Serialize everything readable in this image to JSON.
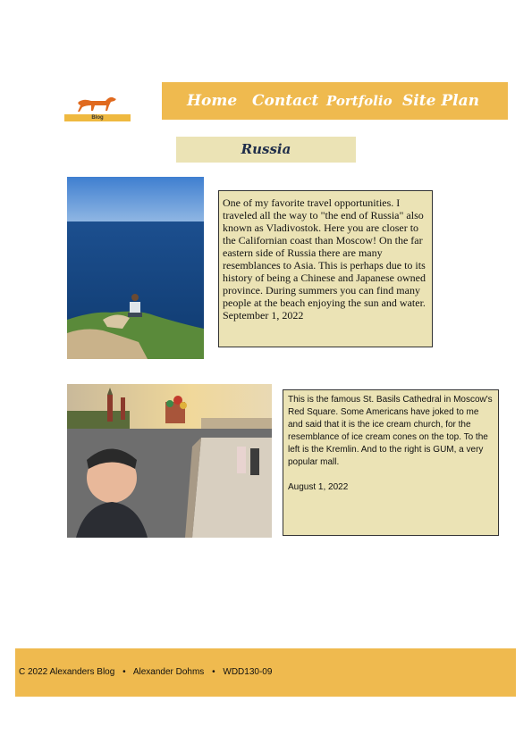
{
  "logo": {
    "label": "Blog"
  },
  "nav": {
    "items": [
      {
        "label": "Home"
      },
      {
        "label": "Contact"
      },
      {
        "label": "Portfolio"
      },
      {
        "label": "Site Plan"
      }
    ]
  },
  "page": {
    "title": "Russia"
  },
  "posts": [
    {
      "body": "One of my favorite travel opportunities. I traveled all the way to \"the end of Russia\" also known as Vladivostok. Here you are closer to the Californian coast than Moscow! On the far eastern side of Russia there are many resemblances to Asia. This is perhaps due to its history of being a Chinese and Japanese owned province. During summers you can find many people at the beach enjoying the sun and water.",
      "date": "September 1, 2022"
    },
    {
      "body": "This is the famous St. Basils Cathedral in Moscow's Red Square. Some Americans have joked to me and said that it is the ice cream church, for the resemblance of ice cream cones on the top. To the left is the Kremlin. And to the right is GUM, a very popular mall.",
      "date": "August 1, 2022"
    }
  ],
  "footer": {
    "copyright": "C 2022 Alexanders Blog",
    "author": "Alexander Dohms",
    "course": "WDD130-09",
    "separator": "•"
  },
  "colors": {
    "accent": "#efba4f",
    "box": "#ebe3b5",
    "title_text": "#1f2d4a"
  }
}
